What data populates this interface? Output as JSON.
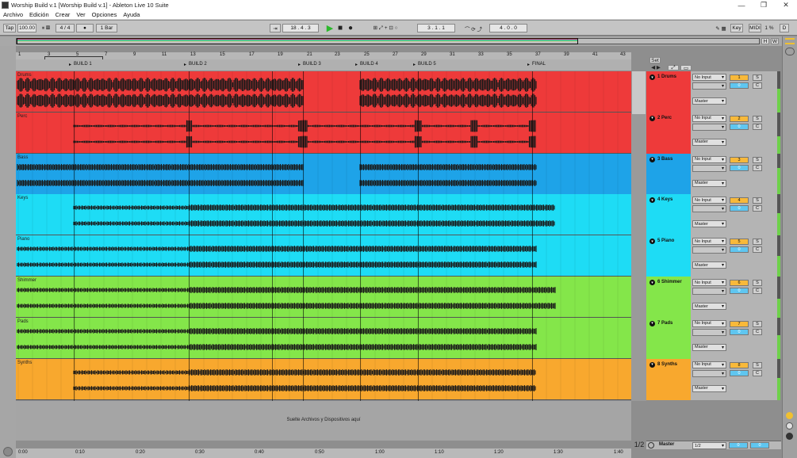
{
  "window": {
    "title": "Worship Build v.1  [Worship Build v.1] - Ableton Live 10 Suite",
    "minimize": "—",
    "maximize": "❐",
    "close": "✕"
  },
  "menu": [
    "Archivo",
    "Edición",
    "Crear",
    "Ver",
    "Opciones",
    "Ayuda"
  ],
  "control": {
    "tap": "Tap",
    "tempo": "100.00",
    "signature": "4 / 4",
    "metronome": "●",
    "quantize": "1 Bar",
    "position": "18 . 4 . 3",
    "loop_start": "3 . 1 . 1",
    "loop_length": "4 . 0 . 0",
    "key": "Key",
    "midi": "MIDI",
    "cpu": "1 %",
    "d": "D"
  },
  "overview": {
    "h": "H",
    "w": "W"
  },
  "set_label": "Set",
  "ruler_bars": [
    "1",
    "3",
    "5",
    "7",
    "9",
    "11",
    "13",
    "15",
    "17",
    "19",
    "21",
    "23",
    "25",
    "27",
    "29",
    "31",
    "33",
    "35",
    "37",
    "39",
    "41",
    "43"
  ],
  "locators": [
    {
      "label": "BUILD 1"
    },
    {
      "label": "BUILD 2"
    },
    {
      "label": "BUILD 3"
    },
    {
      "label": "BUILD 4"
    },
    {
      "label": "BUILD 5"
    },
    {
      "label": "FINAL"
    }
  ],
  "tracks": [
    {
      "lane_name": "Drums",
      "name": "1 Drums",
      "num": "1",
      "color": "#ee3a3a",
      "io_in": "No Input",
      "io_out": "Master",
      "vol": "0",
      "solo": "S",
      "cue": "C"
    },
    {
      "lane_name": "Perc",
      "name": "2 Perc",
      "num": "2",
      "color": "#ee3a3a",
      "io_in": "No Input",
      "io_out": "Master",
      "vol": "0",
      "solo": "S",
      "cue": "C"
    },
    {
      "lane_name": "Bass",
      "name": "3 Bass",
      "num": "3",
      "color": "#1ea3e8",
      "io_in": "No Input",
      "io_out": "Master",
      "vol": "0",
      "solo": "S",
      "cue": "C"
    },
    {
      "lane_name": "Keys",
      "name": "4 Keys",
      "num": "4",
      "color": "#1edcf5",
      "io_in": "No Input",
      "io_out": "Master",
      "vol": "0",
      "solo": "S",
      "cue": "C"
    },
    {
      "lane_name": "Piano",
      "name": "5 Piano",
      "num": "5",
      "color": "#1edcf5",
      "io_in": "No Input",
      "io_out": "Master",
      "vol": "0",
      "solo": "S",
      "cue": "C"
    },
    {
      "lane_name": "Shimmer",
      "name": "6 Shimmer",
      "num": "6",
      "color": "#84e64a",
      "io_in": "No Input",
      "io_out": "Master",
      "vol": "0",
      "solo": "S",
      "cue": "C"
    },
    {
      "lane_name": "Pads",
      "name": "7 Pads",
      "num": "7",
      "color": "#84e64a",
      "io_in": "No Input",
      "io_out": "Master",
      "vol": "0",
      "solo": "S",
      "cue": "C"
    },
    {
      "lane_name": "Synths",
      "name": "8 Synths",
      "num": "8",
      "color": "#f8a82e",
      "io_in": "No Input",
      "io_out": "Master",
      "vol": "0",
      "solo": "S",
      "cue": "C"
    }
  ],
  "dropzone_text": "Suelte Archivos y Dispositivos aquí",
  "master": {
    "name": "Master",
    "output": "1/2",
    "vol": "0",
    "pan": "0",
    "page": "1/2"
  },
  "timebar": [
    "0:00",
    "0:10",
    "0:20",
    "0:30",
    "0:40",
    "0:50",
    "1:00",
    "1:10",
    "1:20",
    "1:30",
    "1:40"
  ]
}
